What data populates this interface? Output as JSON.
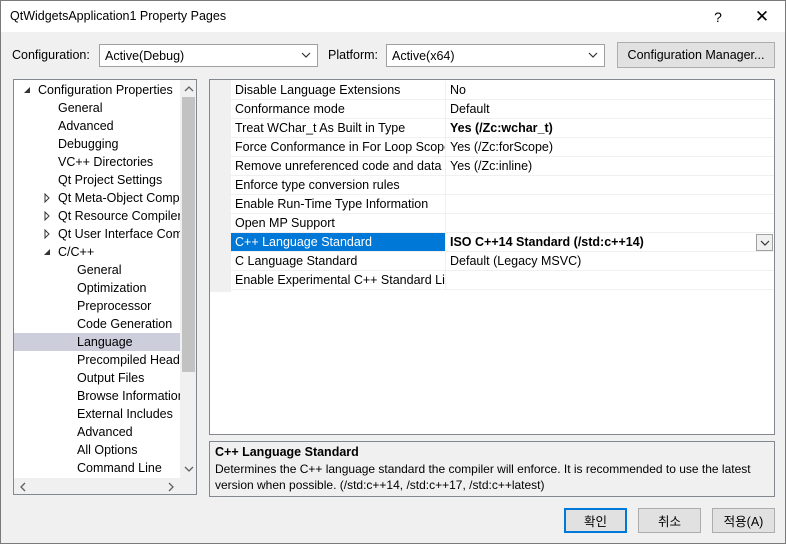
{
  "window": {
    "title": "QtWidgetsApplication1 Property Pages",
    "help_label": "?",
    "close_label": "✕"
  },
  "toolbar": {
    "configuration_label": "Configuration:",
    "configuration_value": "Active(Debug)",
    "platform_label": "Platform:",
    "platform_value": "Active(x64)",
    "config_manager_label": "Configuration Manager..."
  },
  "tree": {
    "items": [
      {
        "label": "Configuration Properties",
        "expander": "expanded"
      },
      {
        "label": "General"
      },
      {
        "label": "Advanced"
      },
      {
        "label": "Debugging"
      },
      {
        "label": "VC++ Directories"
      },
      {
        "label": "Qt Project Settings"
      },
      {
        "label": "Qt Meta-Object Comp",
        "expander": "collapsed"
      },
      {
        "label": "Qt Resource Compiler",
        "expander": "collapsed"
      },
      {
        "label": "Qt User Interface Comp",
        "expander": "collapsed"
      },
      {
        "label": "C/C++",
        "expander": "expanded"
      },
      {
        "label": "General"
      },
      {
        "label": "Optimization"
      },
      {
        "label": "Preprocessor"
      },
      {
        "label": "Code Generation"
      },
      {
        "label": "Language",
        "selected": true
      },
      {
        "label": "Precompiled Heade"
      },
      {
        "label": "Output Files"
      },
      {
        "label": "Browse Information"
      },
      {
        "label": "External Includes"
      },
      {
        "label": "Advanced"
      },
      {
        "label": "All Options"
      },
      {
        "label": "Command Line"
      }
    ]
  },
  "grid": {
    "rows": [
      {
        "name": "Disable Language Extensions",
        "value": "No"
      },
      {
        "name": "Conformance mode",
        "value": "Default"
      },
      {
        "name": "Treat WChar_t As Built in Type",
        "value": "Yes (/Zc:wchar_t)",
        "bold": true
      },
      {
        "name": "Force Conformance in For Loop Scope",
        "value": "Yes (/Zc:forScope)"
      },
      {
        "name": "Remove unreferenced code and data",
        "value": "Yes (/Zc:inline)"
      },
      {
        "name": "Enforce type conversion rules",
        "value": ""
      },
      {
        "name": "Enable Run-Time Type Information",
        "value": ""
      },
      {
        "name": "Open MP Support",
        "value": ""
      },
      {
        "name": "C++ Language Standard",
        "value": "ISO C++14 Standard (/std:c++14)",
        "selected": true
      },
      {
        "name": "C Language Standard",
        "value": "Default (Legacy MSVC)"
      },
      {
        "name": "Enable Experimental C++ Standard Lib",
        "value": ""
      }
    ]
  },
  "description": {
    "title": "C++ Language Standard",
    "text": "Determines the C++ language standard the compiler will enforce. It is recommended to use the latest version when possible. (/std:c++14, /std:c++17, /std:c++latest)"
  },
  "buttons": {
    "ok": "확인",
    "cancel": "취소",
    "apply": "적용(A)"
  },
  "colors": {
    "selection": "#0078d7",
    "tree_selection": "#cccedb"
  }
}
